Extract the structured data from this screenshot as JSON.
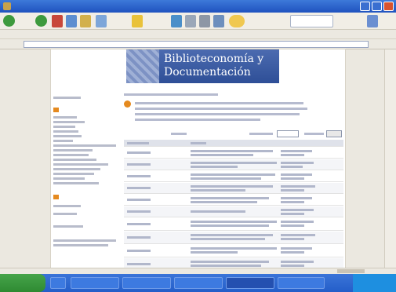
{
  "window": {
    "title": ""
  },
  "menu": {
    "items": []
  },
  "header": {
    "line1": "Biblioteconomía y",
    "line2": "Documentación"
  },
  "sidebar": {
    "section1": "",
    "section2": "",
    "section3": ""
  },
  "icons": {
    "back": "back-arrow-icon",
    "forward": "forward-arrow-icon",
    "stop": "stop-icon",
    "refresh": "refresh-icon",
    "home": "home-icon",
    "search": "search-icon",
    "favorites": "star-icon",
    "history": "history-icon",
    "mail": "mail-icon",
    "print": "printer-icon",
    "edit": "edit-icon",
    "messenger": "messenger-icon"
  },
  "colors": {
    "header_bg": "#3a5aa2",
    "section_bullet": "#e58a1f",
    "taskbar": "#2a63d0",
    "start_button": "#3a9a3d"
  }
}
